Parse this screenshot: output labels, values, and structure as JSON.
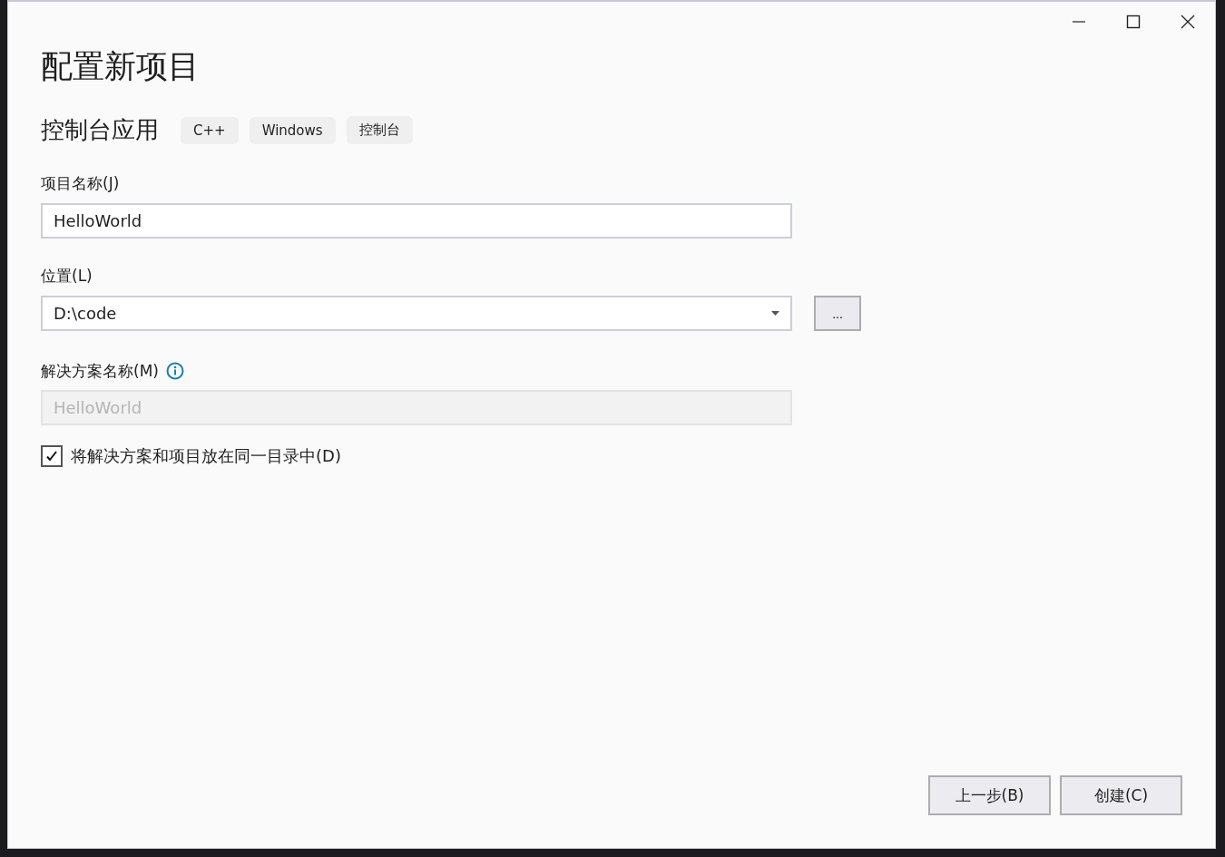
{
  "window": {
    "title": "配置新项目"
  },
  "template": {
    "name": "控制台应用",
    "tags": [
      "C++",
      "Windows",
      "控制台"
    ]
  },
  "project_name": {
    "label": "项目名称(J)",
    "value": "HelloWorld"
  },
  "location": {
    "label": "位置(L)",
    "value": "D:\\code",
    "browse": "..."
  },
  "solution_name": {
    "label": "解决方案名称(M)",
    "value": "HelloWorld",
    "disabled": true
  },
  "same_directory": {
    "label": "将解决方案和项目放在同一目录中(D)",
    "checked": true
  },
  "buttons": [
    "上一步(B)",
    "创建(C)"
  ]
}
